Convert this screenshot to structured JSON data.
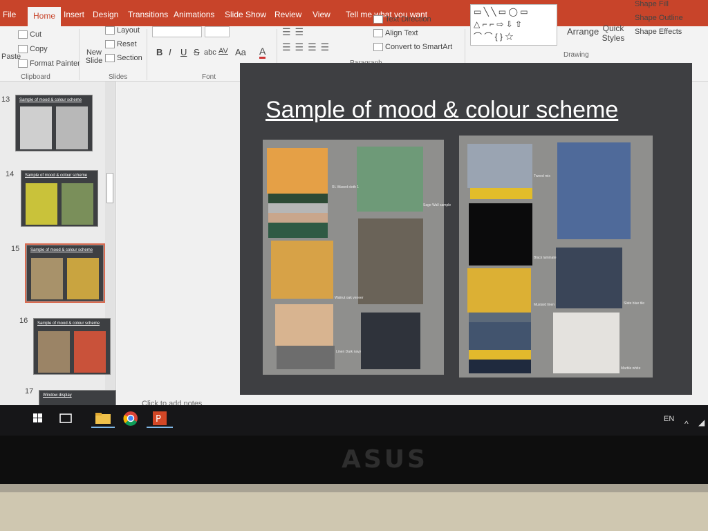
{
  "ribbon_tabs": [
    "File",
    "Home",
    "Insert",
    "Design",
    "Transitions",
    "Animations",
    "Slide Show",
    "Review",
    "View",
    "Tell me what you want"
  ],
  "clipboard": {
    "paste": "Paste",
    "cut": "Cut",
    "copy": "Copy",
    "format_painter": "Format Painter",
    "group": "Clipboard"
  },
  "slides_group": {
    "new_slide": "New Slide",
    "layout": "Layout",
    "reset": "Reset",
    "section": "Section",
    "group": "Slides"
  },
  "font_group": {
    "bold": "B",
    "italic": "I",
    "underline": "U",
    "strike": "S",
    "shadow": "abc",
    "spacing": "AV",
    "case": "Aa",
    "color": "A",
    "group": "Font"
  },
  "paragraph_group": {
    "text_direction": "Text Direction",
    "align_text": "Align Text",
    "convert": "Convert to SmartArt",
    "group": "Paragraph"
  },
  "drawing_group": {
    "arrange": "Arrange",
    "quick_styles": "Quick Styles",
    "shape_fill": "Shape Fill",
    "shape_outline": "Shape Outline",
    "shape_effects": "Shape Effects",
    "group": "Drawing"
  },
  "thumbnails": [
    {
      "num": "13",
      "title": "Sample of mood & colour scheme"
    },
    {
      "num": "14",
      "title": "Sample of mood & colour scheme"
    },
    {
      "num": "15",
      "title": "Sample of mood & colour scheme"
    },
    {
      "num": "16",
      "title": "Sample of mood & colour scheme"
    },
    {
      "num": "17",
      "title": "Window display"
    }
  ],
  "slide": {
    "title": "Sample of mood & colour scheme",
    "captions": [
      "RL Waxed cloth 1",
      "Sage Wall sample",
      "Walnut oak veneer",
      "Linen Dark navy",
      "Tweed mix",
      "Black laminate",
      "Mustard linen",
      "Slate blue tile",
      "Marble white"
    ]
  },
  "notes_placeholder": "Click to add notes",
  "tray": {
    "lang": "EN",
    "chevron": "^"
  },
  "brand": "ASUS",
  "colors": {
    "ribbon": "#c8442a",
    "slide_bg": "#3e3f42",
    "board": "#8f8f8d"
  }
}
